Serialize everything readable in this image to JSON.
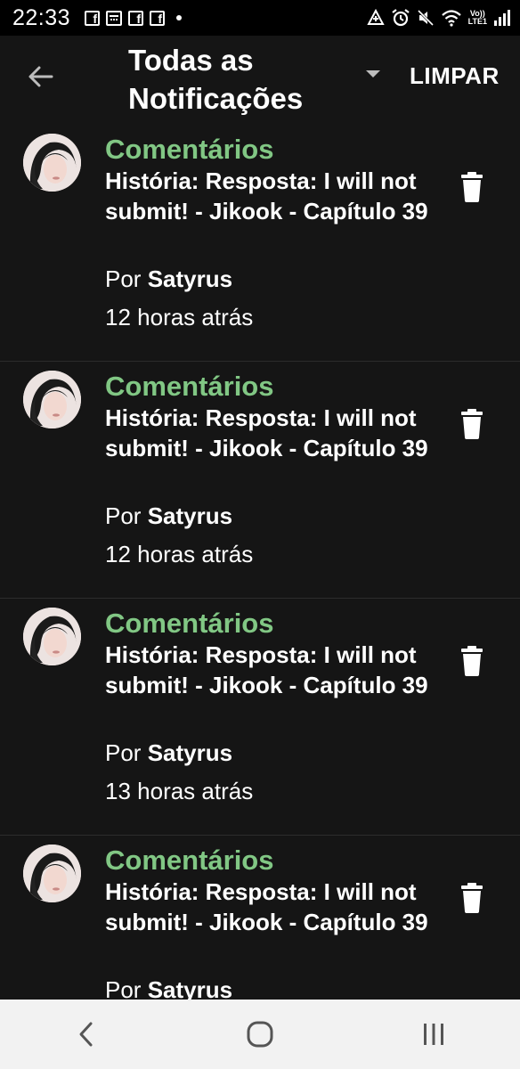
{
  "status_bar": {
    "time": "22:33",
    "left_icons": [
      "facebook-icon",
      "calendar-icon",
      "facebook-icon",
      "facebook-icon",
      "notification-dot"
    ],
    "right_icons": [
      "data-saver-icon",
      "alarm-icon",
      "mute-icon",
      "wifi-icon",
      "volte-icon",
      "signal-icon"
    ],
    "volte_top": "Vo))",
    "volte_bottom": "LTE1"
  },
  "header": {
    "title_line1": "Todas as",
    "title_line2": "Notificações",
    "clear_label": "LIMPAR",
    "back_icon": "arrow-left-icon",
    "dropdown_icon": "caret-down-icon"
  },
  "notifications": [
    {
      "category": "Comentários",
      "story": "História: Resposta: I will not submit! - Jikook - Capítulo 39",
      "author_prefix": "Por",
      "author": "Satyrus",
      "time": "12 horas atrás"
    },
    {
      "category": "Comentários",
      "story": "História: Resposta: I will not submit! - Jikook - Capítulo 39",
      "author_prefix": "Por",
      "author": "Satyrus",
      "time": "12 horas atrás"
    },
    {
      "category": "Comentários",
      "story": "História: Resposta: I will not submit! - Jikook - Capítulo 39",
      "author_prefix": "Por",
      "author": "Satyrus",
      "time": "13 horas atrás"
    },
    {
      "category": "Comentários",
      "story": "História: Resposta: I will not submit! - Jikook - Capítulo 39",
      "author_prefix": "Por",
      "author": "Satyrus",
      "time": ""
    }
  ],
  "nav_bar": {
    "icons": [
      "back-chevron-icon",
      "home-icon",
      "recents-icon"
    ]
  },
  "colors": {
    "background": "#151515",
    "status_bar": "#000000",
    "category_green": "#81c784",
    "divider": "#2c2c2c",
    "nav_bar": "#f2f2f2"
  }
}
